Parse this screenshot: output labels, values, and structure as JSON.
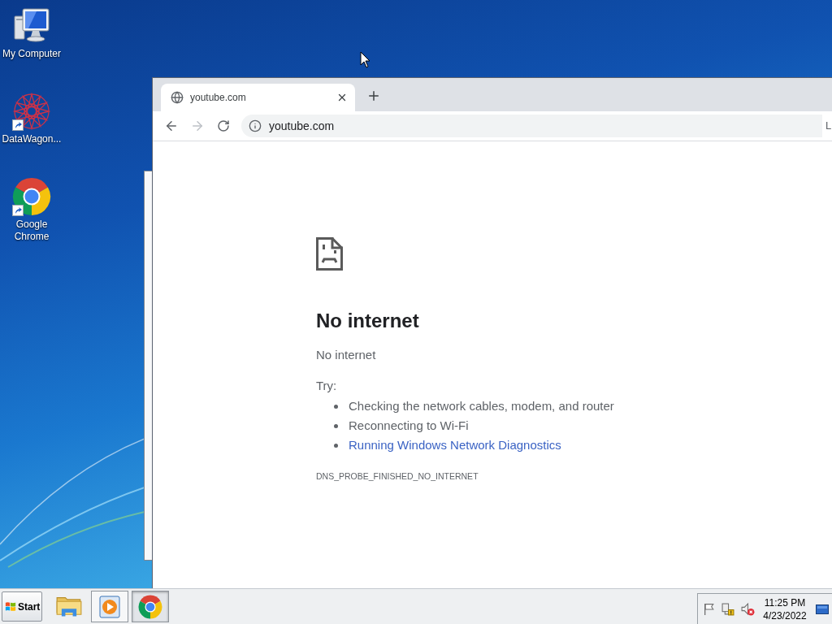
{
  "desktop": {
    "icons": [
      {
        "label": "My Computer",
        "kind": "computer",
        "shortcut": false
      },
      {
        "label": "DataWagon...",
        "kind": "network-app",
        "shortcut": true
      },
      {
        "label": "Google Chrome",
        "kind": "chrome",
        "shortcut": true
      }
    ]
  },
  "browser": {
    "tabs": [
      {
        "title": "youtube.com",
        "selected": true
      }
    ],
    "nav_buttons": [
      {
        "kind": "back",
        "disabled": false
      },
      {
        "kind": "forward",
        "disabled": true
      },
      {
        "kind": "reload",
        "disabled": false
      }
    ],
    "address": "youtube.com",
    "edge_text": "L"
  },
  "error_page": {
    "heading": "No internet",
    "message": "No internet",
    "try_label": "Try:",
    "suggestions": [
      {
        "text": "Checking the network cables, modem, and router",
        "kind": "text"
      },
      {
        "text": "Reconnecting to Wi-Fi",
        "kind": "text"
      },
      {
        "text": "Running Windows Network Diagnostics",
        "kind": "link"
      }
    ],
    "error_code": "DNS_PROBE_FINISHED_NO_INTERNET"
  },
  "taskbar": {
    "start_label": "Start",
    "apps": [
      {
        "kind": "explorer",
        "running": false,
        "selected": false
      },
      {
        "kind": "media-player",
        "running": true,
        "selected": false
      },
      {
        "kind": "chrome",
        "running": true,
        "selected": true
      }
    ],
    "tray": {
      "icons": [
        {
          "kind": "flag"
        },
        {
          "kind": "network",
          "alert": true
        },
        {
          "kind": "volume",
          "muted": true
        }
      ],
      "time": "11:25 PM",
      "date": "4/23/2022"
    }
  }
}
